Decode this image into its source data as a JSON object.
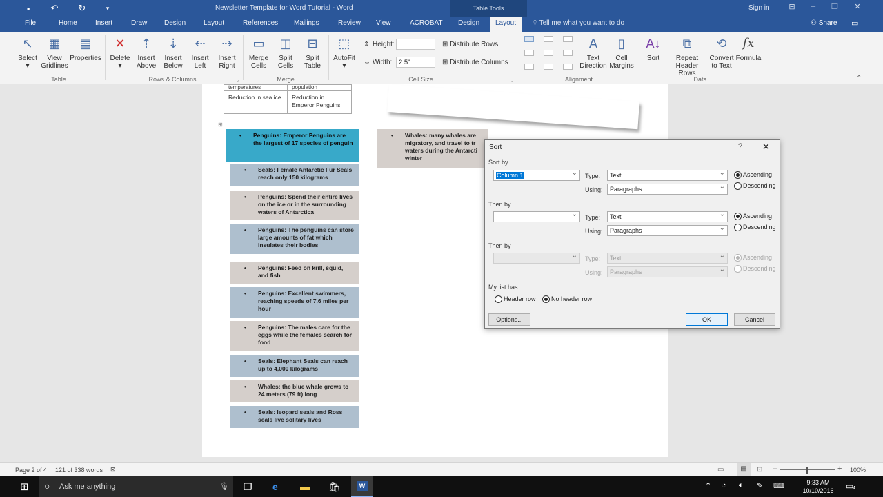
{
  "titlebar": {
    "title": "Newsletter Template for Word Tutorial - Word",
    "table_tools": "Table Tools",
    "sign_in": "Sign in"
  },
  "tabs": [
    "File",
    "Home",
    "Insert",
    "Draw",
    "Design",
    "Layout",
    "References",
    "Mailings",
    "Review",
    "View",
    "ACROBAT",
    "Design",
    "Layout"
  ],
  "tell_me": "Tell me what you want to do",
  "share": "Share",
  "ribbon": {
    "table": {
      "select": "Select",
      "view_gridlines_1": "View",
      "view_gridlines_2": "Gridlines",
      "properties": "Properties",
      "group": "Table"
    },
    "rows_cols": {
      "delete": "Delete",
      "ins_above_1": "Insert",
      "ins_above_2": "Above",
      "ins_below_1": "Insert",
      "ins_below_2": "Below",
      "ins_left_1": "Insert",
      "ins_left_2": "Left",
      "ins_right_1": "Insert",
      "ins_right_2": "Right",
      "group": "Rows & Columns"
    },
    "merge": {
      "merge_1": "Merge",
      "merge_2": "Cells",
      "split_cells_1": "Split",
      "split_cells_2": "Cells",
      "split_table_1": "Split",
      "split_table_2": "Table",
      "group": "Merge"
    },
    "cell_size": {
      "autofit": "AutoFit",
      "height_label": "Height:",
      "height_value": "",
      "width_label": "Width:",
      "width_value": "2.5\"",
      "distribute_rows": "Distribute Rows",
      "distribute_cols": "Distribute Columns",
      "group": "Cell Size"
    },
    "alignment": {
      "text_dir_1": "Text",
      "text_dir_2": "Direction",
      "cell_margins_1": "Cell",
      "cell_margins_2": "Margins",
      "group": "Alignment"
    },
    "data": {
      "sort": "Sort",
      "repeat_1": "Repeat",
      "repeat_2": "Header Rows",
      "convert_1": "Convert",
      "convert_2": "to Text",
      "formula": "Formula",
      "group": "Data"
    }
  },
  "doc": {
    "top_table": [
      {
        "left": "temperatures",
        "right": "population"
      },
      {
        "left": "Reduction in sea ice",
        "right": "Reduction in Emperor Penguins"
      }
    ],
    "list": [
      "Penguins: Emperor Penguins are the largest of 17 species of penguin",
      "Seals: Female Antarctic Fur Seals reach only 150 kilograms",
      "Penguins: Spend their entire lives on the ice or in the surrounding waters of Antarctica",
      "Penguins: The penguins can store large amounts of fat which insulates their bodies",
      "Penguins: Feed on krill, squid, and fish",
      "Penguins: Excellent swimmers, reaching speeds of 7.6 miles per hour",
      "Penguins: The males care for the eggs while the females search for food",
      "Seals: Elephant Seals can reach up to 4,000 kilograms",
      "Whales: the blue whale grows to 24 meters (79 ft) long",
      "Seals: leopard seals and Ross seals live solitary lives"
    ],
    "right_cell": "Whales: many whales are migratory, and travel to tr waters during the Antarcti winter"
  },
  "dialog": {
    "title": "Sort",
    "help": "?",
    "close": "✕",
    "sort_by": "Sort by",
    "sort_by_value": "Column 1",
    "type_label": "Type:",
    "using_label": "Using:",
    "type_value": "Text",
    "using_value": "Paragraphs",
    "ascending": "Ascending",
    "descending": "Descending",
    "then_by_1": "Then by",
    "then_by_2": "Then by",
    "list_has": "My list has",
    "header_row": "Header row",
    "no_header_row": "No header row",
    "options": "Options...",
    "ok": "OK",
    "cancel": "Cancel"
  },
  "status": {
    "page": "Page 2 of 4",
    "words": "121 of 338 words",
    "zoom": "100%"
  },
  "taskbar": {
    "search": "Ask me anything",
    "time": "9:33 AM",
    "date": "10/10/2016",
    "notif_count": "4"
  }
}
